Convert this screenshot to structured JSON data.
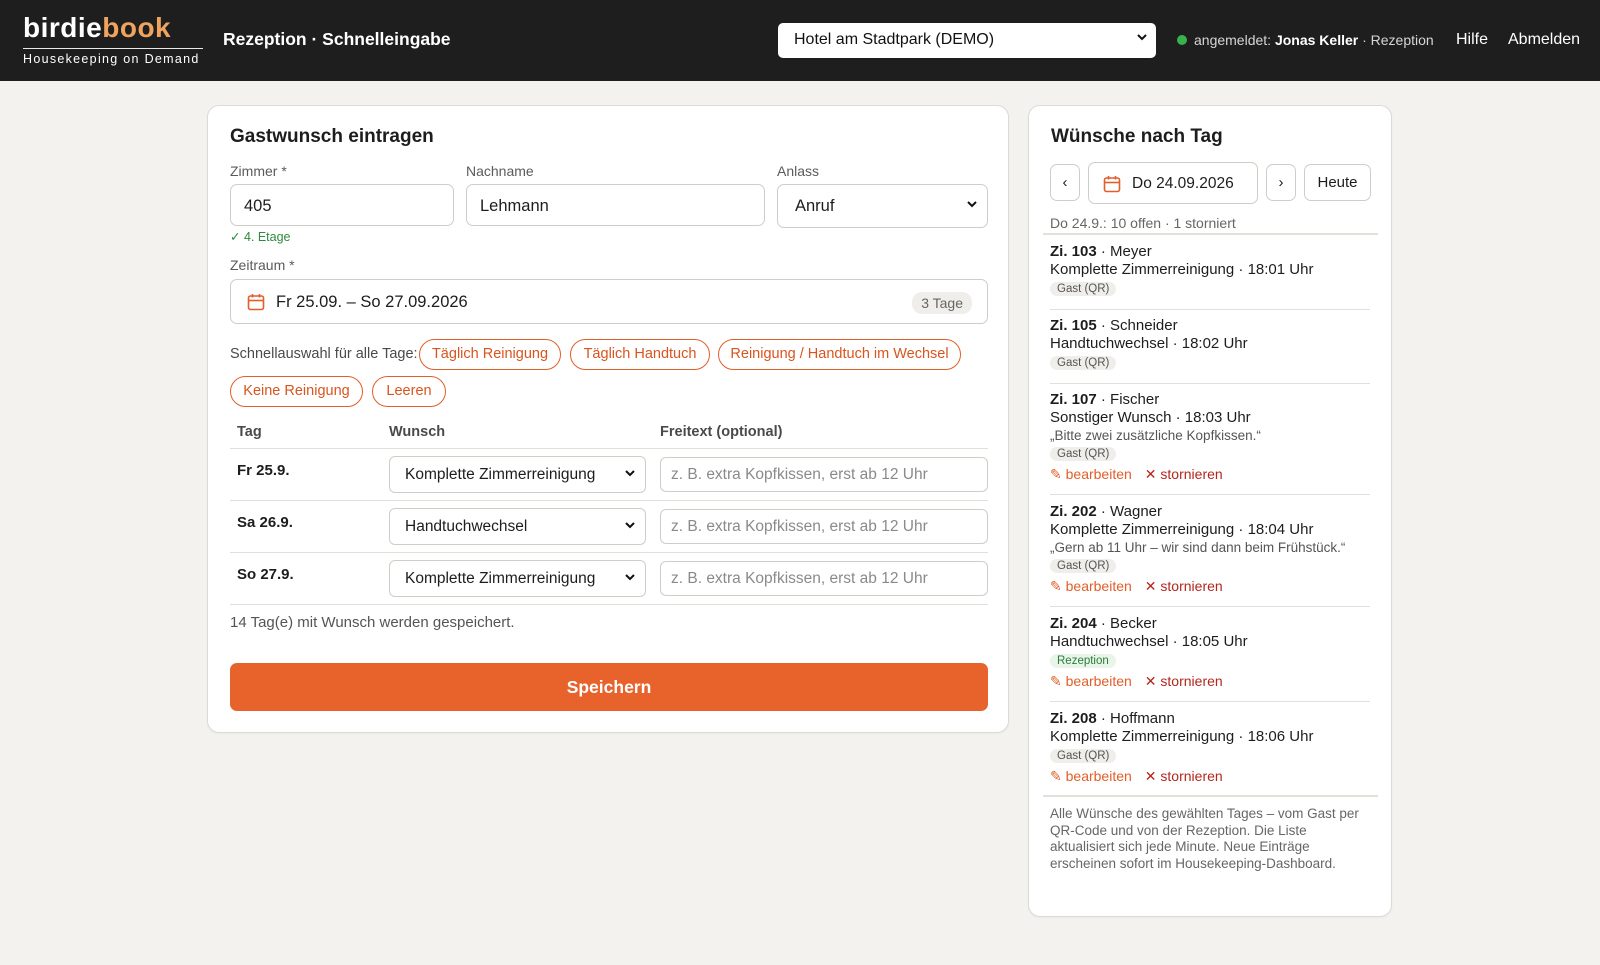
{
  "app": {
    "logo_part1": "birdie",
    "logo_part2": "book",
    "tagline": "Housekeeping on Demand",
    "heading": "Rezeption · Schnelleingabe",
    "hotel_select": "Hotel am Stadtpark (DEMO)",
    "session_prefix": "angemeldet:",
    "user_name": "Jonas Keller",
    "user_role": "· Rezeption",
    "help": "Hilfe",
    "logout": "Abmelden"
  },
  "form": {
    "title": "Gastwunsch eintragen",
    "room_label": "Zimmer *",
    "room_value": "405",
    "room_hint": "✓ 4. Etage",
    "lastname_label": "Nachname",
    "lastname_value": "Lehmann",
    "occasion_label": "Anlass",
    "occasion_value": "Anruf",
    "period_label": "Zeitraum *",
    "period_value": "Fr 25.09. – So 27.09.2026",
    "period_days": "3 Tage",
    "quick_label": "Schnellauswahl für alle Tage:",
    "chips": [
      "Täglich Reinigung",
      "Täglich Handtuch",
      "Reinigung / Handtuch im Wechsel",
      "Keine Reinigung",
      "Leeren"
    ],
    "col_day": "Tag",
    "col_wish": "Wunsch",
    "col_free": "Freitext (optional)",
    "free_placeholder": "z. B. extra Kopfkissen, erst ab 12 Uhr",
    "rows": [
      {
        "day": "Fr 25.9.",
        "wish": "Komplette Zimmerreinigung"
      },
      {
        "day": "Sa 26.9.",
        "wish": "Handtuchwechsel"
      },
      {
        "day": "So 27.9.",
        "wish": "Komplette Zimmerreinigung"
      }
    ],
    "save_note": "14 Tag(e) mit Wunsch werden gespeichert.",
    "save_button": "Speichern"
  },
  "list": {
    "title": "Wünsche nach Tag",
    "prev": "‹",
    "date": "Do 24.09.2026",
    "next": "›",
    "today": "Heute",
    "summary": "Do 24.9.: 10 offen · 1 storniert",
    "edit_label": "✎ bearbeiten",
    "cancel_label": "✕ stornieren",
    "entries": [
      {
        "room": "Zi. 103",
        "name": "· Meyer",
        "service": "Komplette Zimmerreinigung · 18:01 Uhr",
        "source": "Gast (QR)"
      },
      {
        "room": "Zi. 105",
        "name": "· Schneider",
        "service": "Handtuchwechsel · 18:02 Uhr",
        "source": "Gast (QR)"
      },
      {
        "room": "Zi. 107",
        "name": "· Fischer",
        "service": "Sonstiger Wunsch · 18:03 Uhr",
        "note": "„Bitte zwei zusätzliche Kopfkissen.“",
        "source": "Gast (QR)"
      },
      {
        "room": "Zi. 202",
        "name": "· Wagner",
        "service": "Komplette Zimmerreinigung · 18:04 Uhr",
        "note": "„Gern ab 11 Uhr – wir sind dann beim Frühstück.“",
        "source": "Gast (QR)"
      },
      {
        "room": "Zi. 204",
        "name": "· Becker",
        "service": "Handtuchwechsel · 18:05 Uhr",
        "source": "Rezeption"
      },
      {
        "room": "Zi. 208",
        "name": "· Hoffmann",
        "service": "Komplette Zimmerreinigung · 18:06 Uhr",
        "source": "Gast (QR)"
      }
    ],
    "footer": "Alle Wünsche des gewählten Tages – vom Gast per QR-Code und von der Rezeption. Die Liste aktualisiert sich jede Minute. Neue Einträge erscheinen sofort im Housekeeping-Dashboard."
  },
  "colors": {
    "accent": "#e8632c",
    "logo_accent": "#f0a35e",
    "topbar": "#1e1e1e",
    "online": "#37b24d",
    "cancel": "#b3261e"
  }
}
